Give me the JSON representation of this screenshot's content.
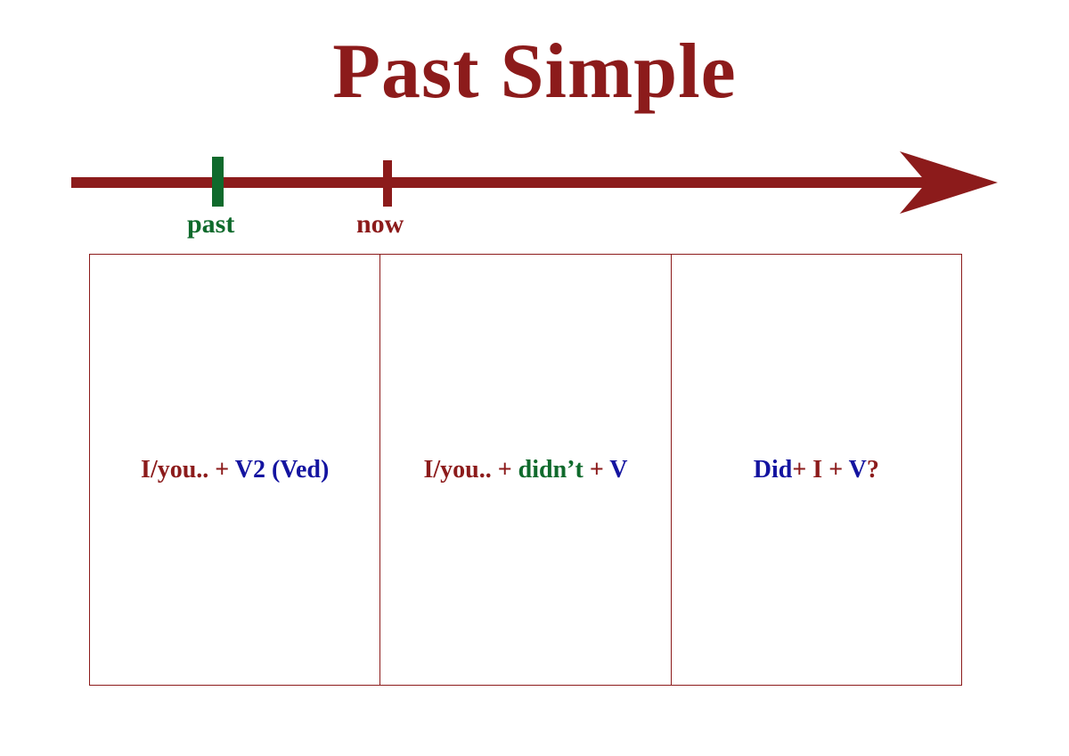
{
  "title": "Past Simple",
  "timeline": {
    "past_label": "past",
    "now_label": "now"
  },
  "colors": {
    "brand": "#8c1b1b",
    "green": "#0f6a2c",
    "blue": "#1414a0"
  },
  "columns": {
    "affirmative": {
      "fragments": [
        {
          "text": "I/you.. ",
          "color_key": "brand"
        },
        {
          "text": "+ ",
          "color_key": "brand"
        },
        {
          "text": "V2 (Ved)",
          "color_key": "blue"
        }
      ]
    },
    "negative": {
      "fragments": [
        {
          "text": "I/you.. ",
          "color_key": "brand"
        },
        {
          "text": "+ ",
          "color_key": "brand"
        },
        {
          "text": "didn’t ",
          "color_key": "green"
        },
        {
          "text": "+  ",
          "color_key": "brand"
        },
        {
          "text": "V",
          "color_key": "blue"
        }
      ]
    },
    "question": {
      "fragments": [
        {
          "text": "Did",
          "color_key": "blue"
        },
        {
          "text": "+ I ",
          "color_key": "brand"
        },
        {
          "text": "+ ",
          "color_key": "brand"
        },
        {
          "text": "V",
          "color_key": "blue"
        },
        {
          "text": "?",
          "color_key": "brand"
        }
      ]
    }
  }
}
